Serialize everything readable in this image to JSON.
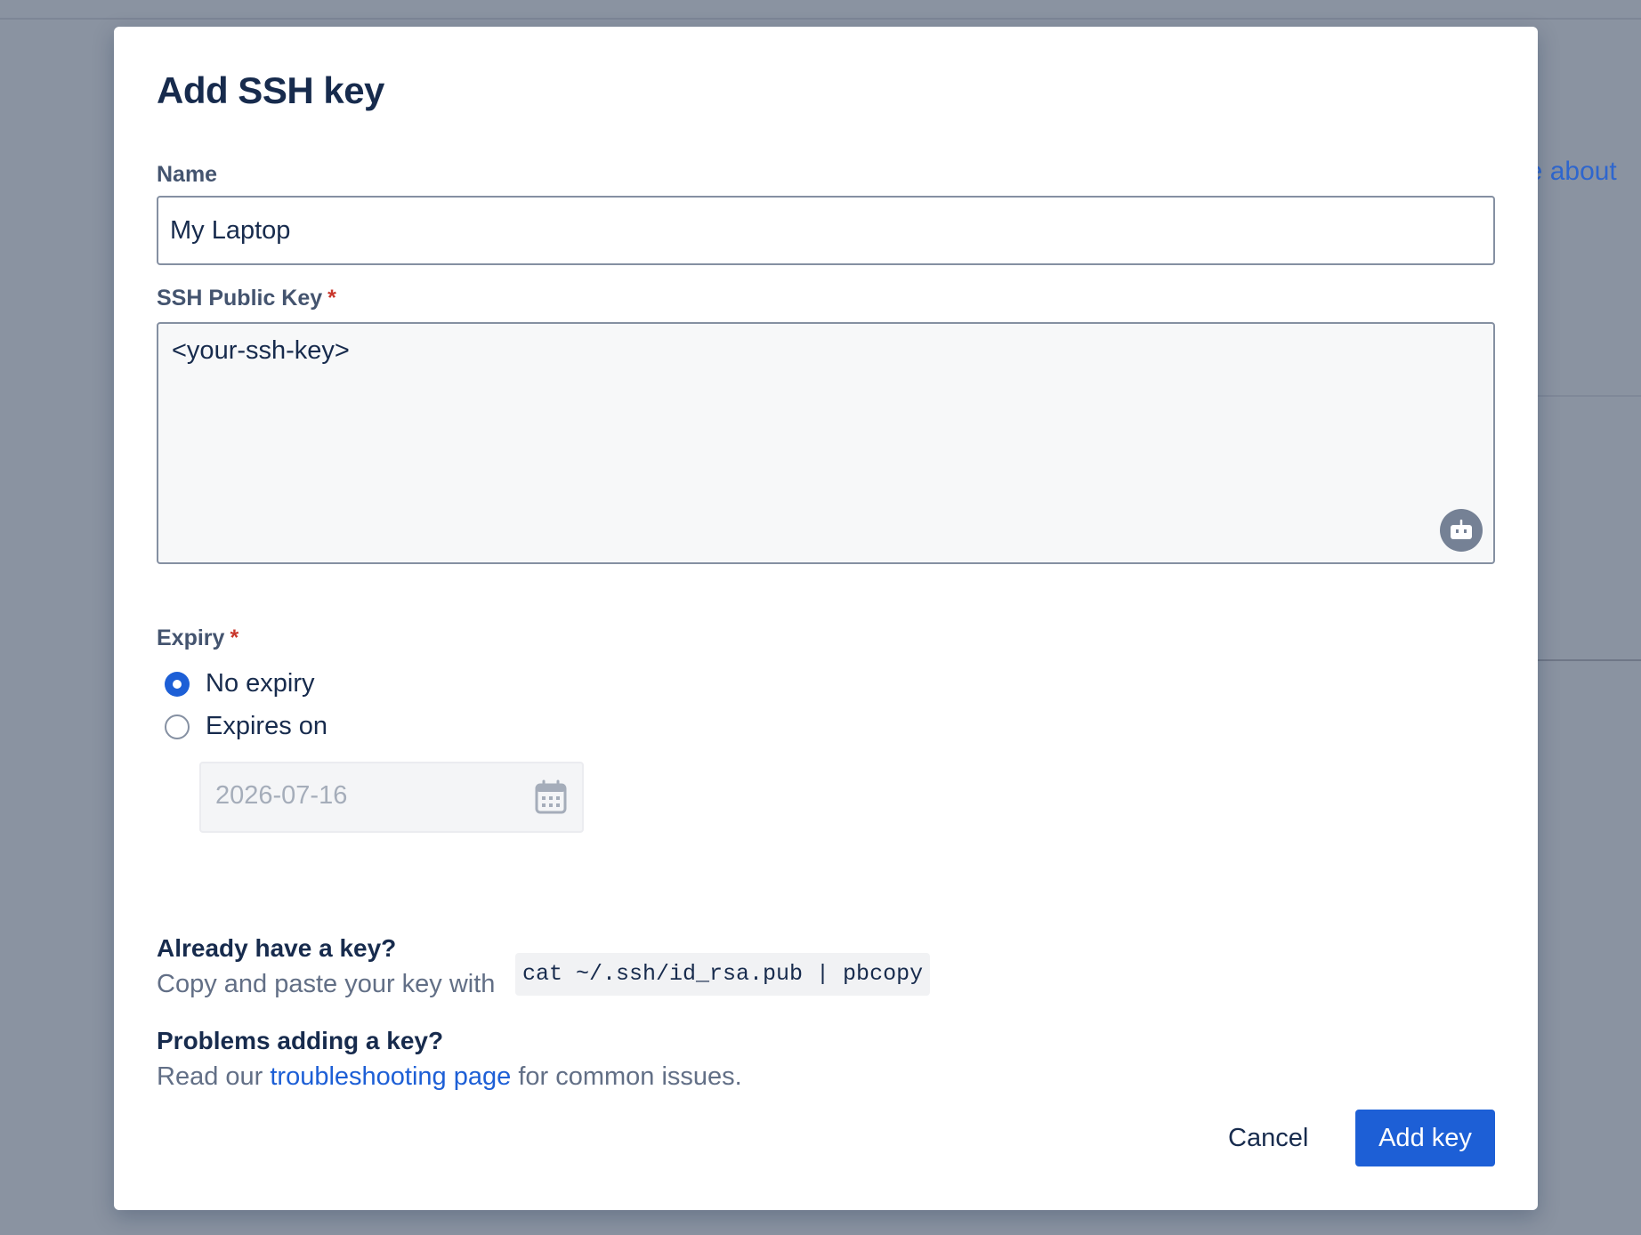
{
  "background": {
    "partial_link_text": "ore about"
  },
  "modal": {
    "title": "Add SSH key",
    "name_field": {
      "label": "Name",
      "value": "My Laptop"
    },
    "ssh_key_field": {
      "label": "SSH Public Key",
      "required_mark": "*",
      "value": "<your-ssh-key>",
      "assist_icon": "robot-icon"
    },
    "expiry": {
      "label": "Expiry",
      "required_mark": "*",
      "options": [
        {
          "label": "No expiry",
          "selected": true
        },
        {
          "label": "Expires on",
          "selected": false
        }
      ],
      "date_value": "2026-07-16",
      "date_icon": "calendar-icon"
    },
    "help": {
      "already_heading": "Already have a key?",
      "already_text": "Copy and paste your key with",
      "command": "cat ~/.ssh/id_rsa.pub | pbcopy",
      "problems_heading": "Problems adding a key?",
      "problems_prefix": "Read our",
      "problems_link": "troubleshooting page",
      "problems_suffix": "for common issues."
    },
    "actions": {
      "cancel_label": "Cancel",
      "submit_label": "Add key"
    },
    "colors": {
      "primary": "#1d5fd6",
      "required": "#c9372c",
      "heading": "#172b4d",
      "overlay": "#8a93a1"
    }
  }
}
